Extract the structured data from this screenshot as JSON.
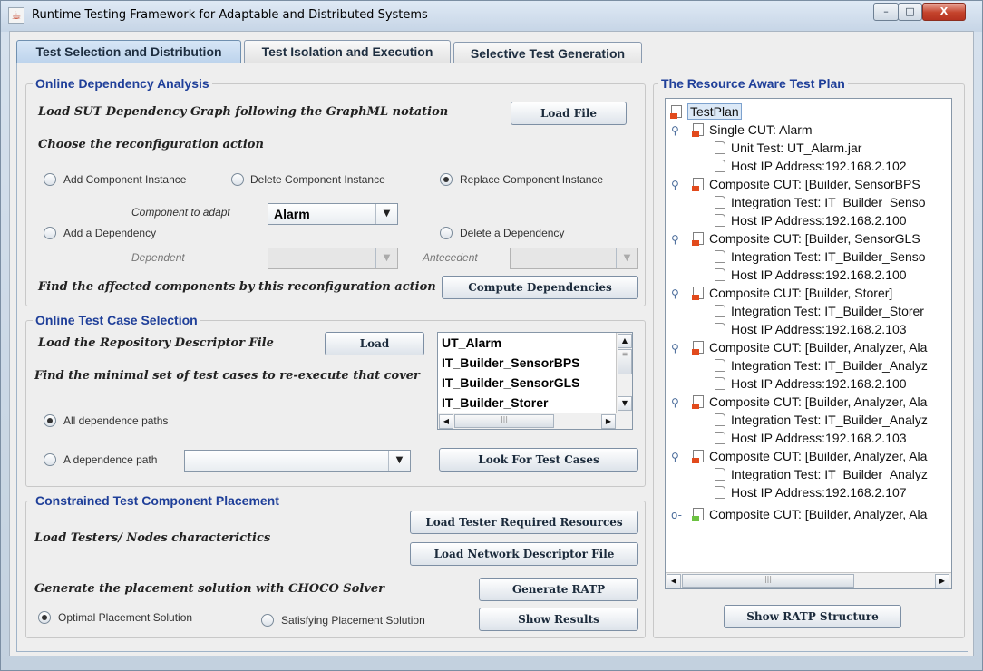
{
  "window": {
    "title": "Runtime Testing Framework for Adaptable and Distributed Systems",
    "app_icon": "java-icon",
    "controls": {
      "minimize": "–",
      "maximize": "□",
      "close": "X"
    }
  },
  "tabs": [
    {
      "label": "Test Selection and Distribution",
      "active": true
    },
    {
      "label": "Test Isolation and Execution",
      "active": false
    },
    {
      "label": "Selective Test Generation",
      "active": false
    }
  ],
  "dependency": {
    "title": "Online Dependency Analysis",
    "load_graph_label": "Load SUT Dependency Graph following the GraphML notation",
    "load_file_button": "Load File",
    "choose_action_label": "Choose the  reconfiguration  action",
    "radios": {
      "add_instance": "Add Component Instance",
      "delete_instance": "Delete  Component Instance",
      "replace_instance": "Replace Component Instance",
      "add_dependency": "Add a Dependency",
      "delete_dependency": "Delete a Dependency"
    },
    "selected_action": "Replace Component Instance",
    "component_to_adapt_label": "Component to adapt",
    "component_to_adapt_value": "Alarm",
    "dependent_label": "Dependent",
    "antecedent_label": "Antecedent",
    "find_affected_label": "Find the affected components by this reconfiguration action",
    "compute_button": "Compute Dependencies"
  },
  "selection": {
    "title": "Online Test Case Selection",
    "load_repo_label": "Load the Repository Descriptor File",
    "load_button": "Load",
    "find_minimal_label": "Find the minimal set of test cases to re-execute that cover",
    "test_cases": [
      "UT_Alarm",
      "IT_Builder_SensorBPS",
      "IT_Builder_SensorGLS",
      "IT_Builder_Storer"
    ],
    "all_paths_radio": "All dependence paths",
    "one_path_radio": "A dependence path",
    "selected_path_option": "All dependence paths",
    "look_button": "Look For Test Cases"
  },
  "placement": {
    "title": "Constrained Test Component Placement",
    "load_testers_label": "Load Testers/ Nodes characterictics",
    "load_tester_button": "Load Tester Required Resources",
    "load_network_button": "Load Network Descriptor File",
    "generate_label": "Generate the placement solution with CHOCO Solver",
    "generate_button": "Generate  RATP",
    "optimal_radio": "Optimal Placement Solution",
    "satisfying_radio": "Satisfying Placement Solution",
    "selected_solution": "Optimal Placement Solution",
    "show_results_button": "Show Results"
  },
  "plan": {
    "title": "The Resource Aware Test Plan",
    "root": "TestPlan",
    "nodes": [
      {
        "label": "Single CUT: Alarm",
        "children": [
          "Unit Test: UT_Alarm.jar",
          "Host IP Address:192.168.2.102"
        ]
      },
      {
        "label": "Composite CUT: [Builder, SensorBPS",
        "children": [
          "Integration Test: IT_Builder_Senso",
          "Host IP Address:192.168.2.100"
        ]
      },
      {
        "label": "Composite CUT: [Builder, SensorGLS",
        "children": [
          "Integration Test: IT_Builder_Senso",
          "Host IP Address:192.168.2.100"
        ]
      },
      {
        "label": "Composite CUT: [Builder, Storer]",
        "children": [
          "Integration Test: IT_Builder_Storer",
          "Host IP Address:192.168.2.103"
        ]
      },
      {
        "label": "Composite CUT: [Builder, Analyzer, Ala",
        "children": [
          "Integration Test: IT_Builder_Analyz",
          "Host IP Address:192.168.2.100"
        ]
      },
      {
        "label": "Composite CUT: [Builder, Analyzer, Ala",
        "children": [
          "Integration Test: IT_Builder_Analyz",
          "Host IP Address:192.168.2.103"
        ]
      },
      {
        "label": "Composite CUT: [Builder, Analyzer, Ala",
        "children": [
          "Integration Test: IT_Builder_Analyz",
          "Host IP Address:192.168.2.107"
        ]
      },
      {
        "label": "Composite CUT: [Builder, Analyzer, Ala",
        "children": []
      }
    ],
    "show_structure_button": "Show RATP Structure"
  }
}
